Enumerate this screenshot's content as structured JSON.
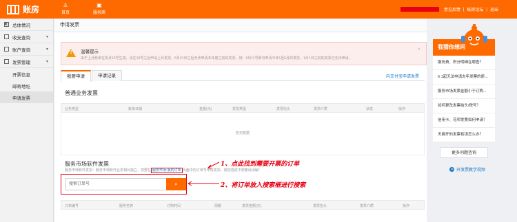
{
  "header": {
    "logo_text": "账房",
    "nav": [
      {
        "label": "首页",
        "icon": "user-icon"
      },
      {
        "label": "服务商",
        "icon": "shop-icon"
      }
    ],
    "links": [
      "意见反馈",
      "账房论坛",
      "退出"
    ],
    "separator": "|"
  },
  "sidebar": {
    "items": [
      {
        "label": "总体情况",
        "icon": "overview-icon",
        "has_arrow": false
      },
      {
        "label": "收支查询",
        "icon": "income-icon",
        "has_arrow": true
      },
      {
        "label": "账户查询",
        "icon": "account-icon",
        "has_arrow": true
      },
      {
        "label": "发票管理",
        "icon": "invoice-icon",
        "has_arrow": true
      }
    ],
    "sub_items": [
      "开票信息",
      "邮寄地址",
      "申请发票"
    ],
    "active_sub": "申请发票",
    "arrow_glyph": "▼"
  },
  "main": {
    "page_title": "申请发票",
    "notice": {
      "icon_glyph": "!",
      "title": "温馨提示",
      "text": "由于上月账单在本月10号生成，请在10号之后申请上月发票，5月31日之后无法申请本年度之前的发票。例：6月11号即可申请今年1至5月的发票，1月1日之前的发票已无法申请。",
      "close": "×"
    },
    "tabs": [
      "我要申请",
      "申请记录"
    ],
    "tab_link": "向支付宝申请发票",
    "general": {
      "title": "普通业务发票",
      "columns": [
        "业务类型",
        "账单日期",
        "金额(元)",
        "发票类型",
        "发票抬头",
        "发票介质",
        "状态",
        "操作"
      ],
      "empty_text": "暂无数据"
    },
    "software": {
      "title": "服务市场软件发票",
      "desc_before": "服务市场软件发票：服务市场软件业务相对独立，您要在",
      "desc_link": "服务市场-我的订单",
      "desc_after": "页面中的订单号申请发票，输您选成不便敬请谅解！",
      "search_placeholder": "搜索订单号",
      "search_icon": "🔍",
      "columns": [
        "订单编号",
        "服务名称",
        "订购时间",
        "周期",
        "发票金额(元)",
        "发票抬头",
        "发票介质",
        "操作"
      ]
    },
    "annotations": [
      "1、点此找到需要开票的订单",
      "2、将订单放入搜索框进行搜索"
    ]
  },
  "help": {
    "title": "我猜你想问",
    "items": [
      "服务费、积分明细在哪查？",
      "6.1起无法申请去年发票的原...",
      "服务市场发票金额小于订购...",
      "如何更改发票抬头/税号？",
      "信用卡、花呗发票如何申请？",
      "天猫开的发票有误怎么办？"
    ],
    "more_button": "更多问题咨询",
    "video_link": "开发票教学视频"
  },
  "colors": {
    "brand": "#ff6a00",
    "link": "#1e7cc8",
    "annotation": "#e60012"
  }
}
